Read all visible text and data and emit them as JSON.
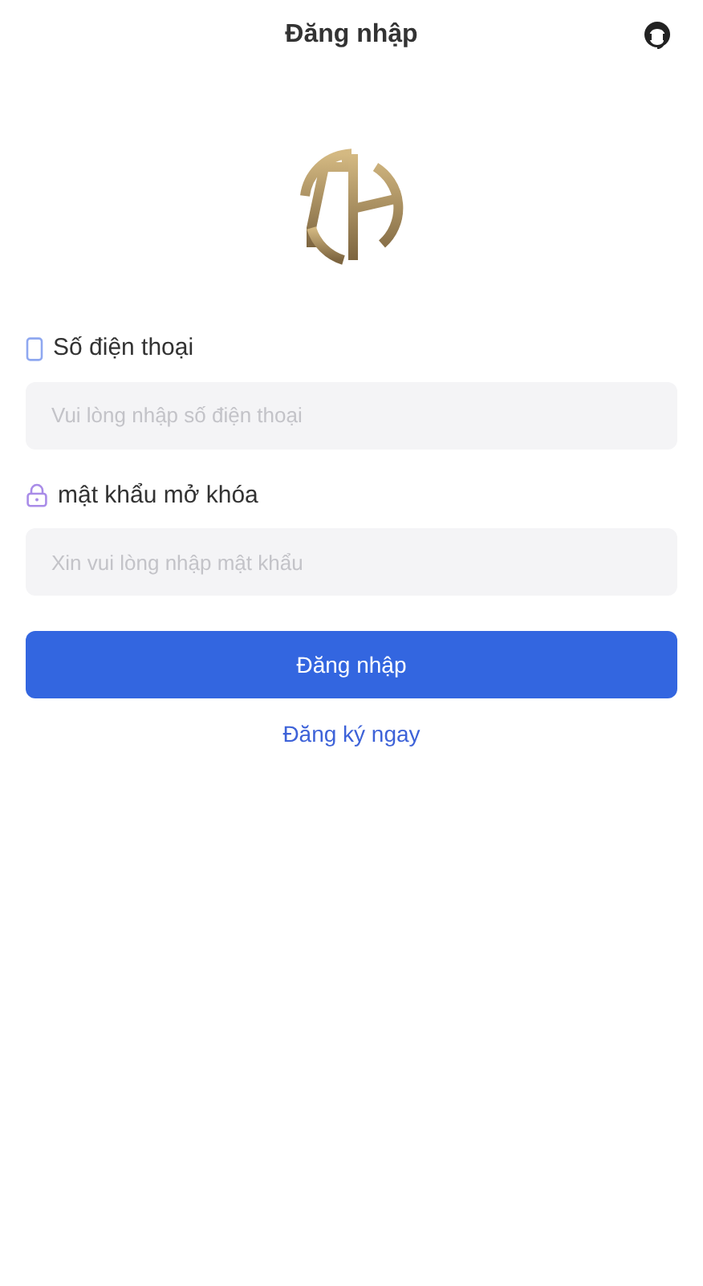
{
  "header": {
    "title": "Đăng nhập"
  },
  "fields": [
    {
      "kind": "phone",
      "label": "Số điện thoại",
      "placeholder": "Vui lòng nhập số điện thoại"
    },
    {
      "kind": "lock",
      "label": "mật khẩu mở khóa",
      "placeholder": "Xin vui lòng nhập mật khẩu"
    }
  ],
  "submit_button": "Đăng nhập",
  "register_link": "Đăng ký ngay"
}
